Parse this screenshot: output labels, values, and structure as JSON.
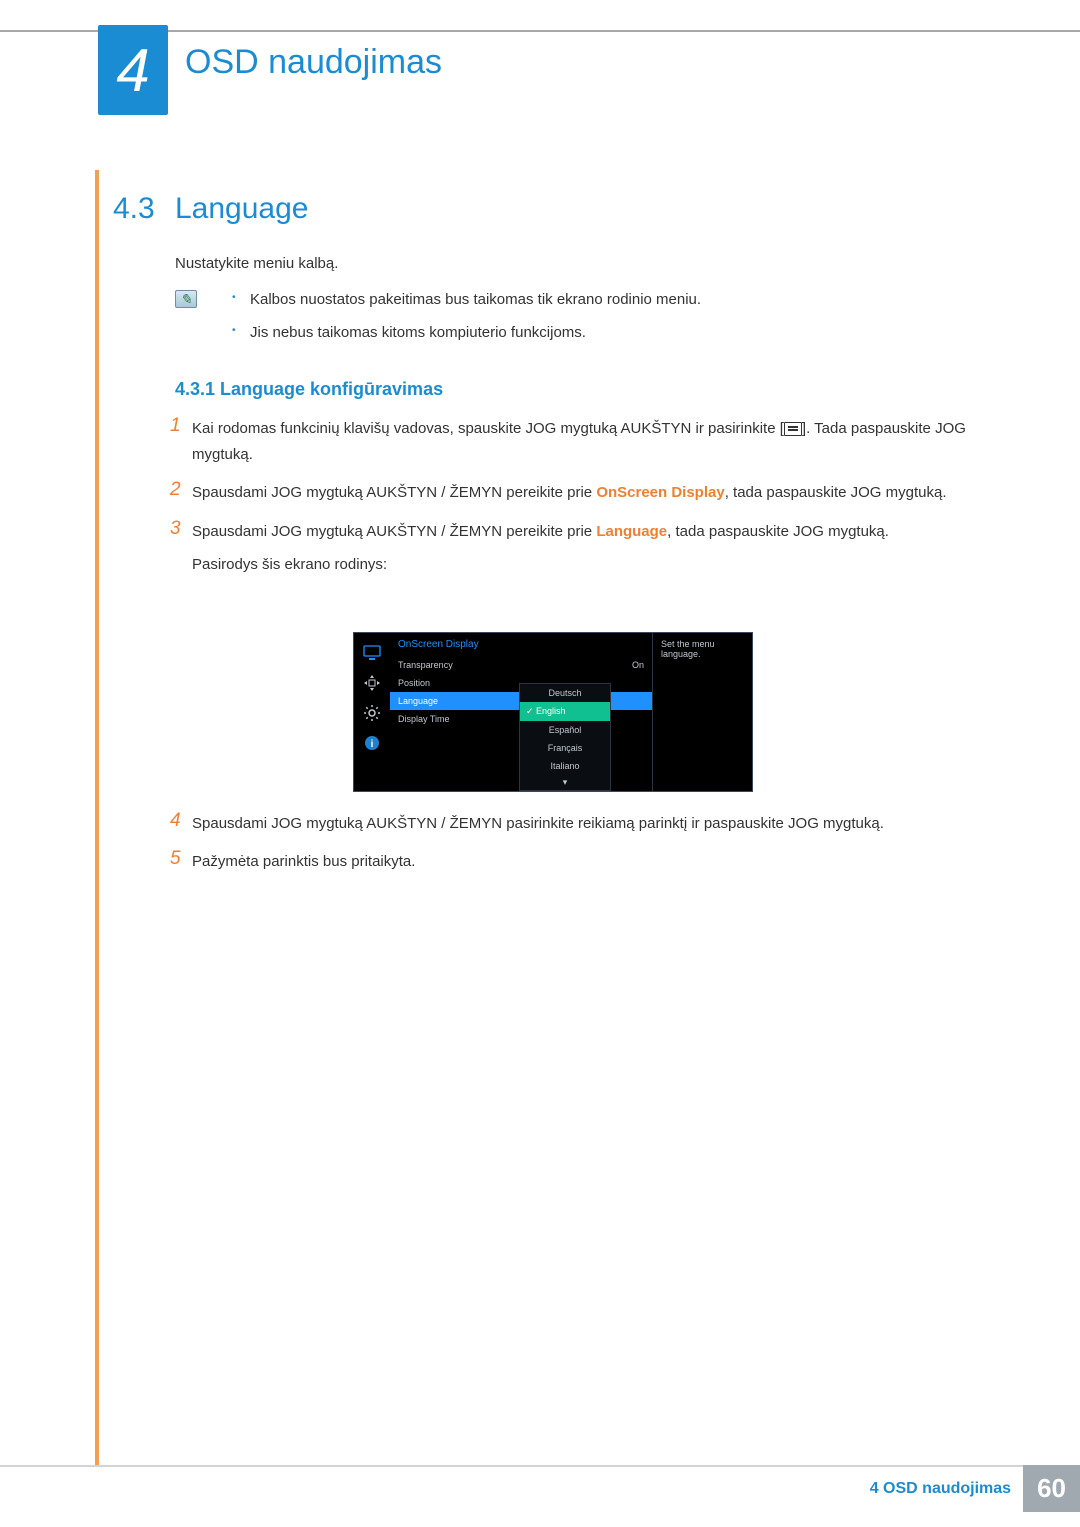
{
  "chapter": {
    "number": "4",
    "title": "OSD naudojimas"
  },
  "section": {
    "number": "4.3",
    "title": "Language"
  },
  "intro": "Nustatykite meniu kalbą.",
  "notes": [
    "Kalbos nuostatos pakeitimas bus taikomas tik ekrano rodinio meniu.",
    "Jis nebus taikomas kitoms kompiuterio funkcijoms."
  ],
  "subsection": "4.3.1  Language konfigūravimas",
  "steps": {
    "s1a": "Kai rodomas funkcinių klavišų vadovas, spauskite JOG mygtuką AUKŠTYN ir pasirinkite [",
    "s1b": "]. Tada paspauskite JOG mygtuką.",
    "s2a": "Spausdami JOG mygtuką AUKŠTYN / ŽEMYN pereikite prie ",
    "s2_hl": "OnScreen Display",
    "s2b": ", tada paspauskite JOG mygtuką.",
    "s3a": "Spausdami JOG mygtuką AUKŠTYN / ŽEMYN pereikite prie ",
    "s3_hl": "Language",
    "s3b": ", tada paspauskite JOG mygtuką.",
    "s3c": "Pasirodys šis ekrano rodinys:",
    "s4": "Spausdami JOG mygtuką AUKŠTYN / ŽEMYN pasirinkite reikiamą parinktį ir paspauskite JOG mygtuką.",
    "s5": "Pažymėta parinktis bus pritaikyta."
  },
  "osd": {
    "header": "OnScreen Display",
    "items": [
      {
        "label": "Transparency",
        "value": "On"
      },
      {
        "label": "Position",
        "value": ""
      },
      {
        "label": "Language",
        "value": "",
        "selected": true
      },
      {
        "label": "Display Time",
        "value": ""
      }
    ],
    "hint": "Set the menu language.",
    "submenu": [
      "Deutsch",
      "English",
      "Español",
      "Français",
      "Italiano"
    ],
    "submenu_selected": "English"
  },
  "footer": {
    "text": "4 OSD naudojimas",
    "page": "60"
  }
}
